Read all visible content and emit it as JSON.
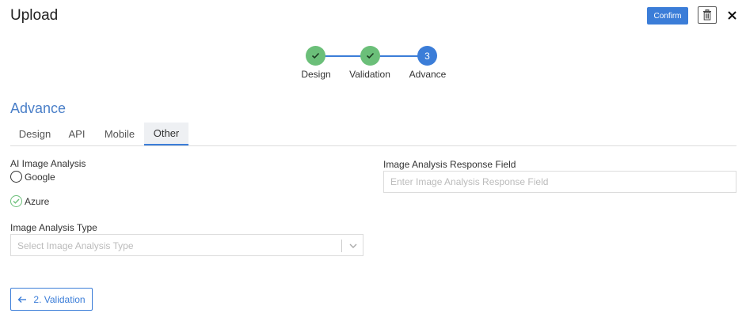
{
  "header": {
    "title": "Upload",
    "confirm_label": "Confirm"
  },
  "stepper": {
    "steps": [
      {
        "label": "Design",
        "status": "done"
      },
      {
        "label": "Validation",
        "status": "done"
      },
      {
        "label": "Advance",
        "status": "active",
        "number": "3"
      }
    ]
  },
  "section": {
    "title": "Advance",
    "tabs": [
      {
        "label": "Design",
        "active": false
      },
      {
        "label": "API",
        "active": false
      },
      {
        "label": "Mobile",
        "active": false
      },
      {
        "label": "Other",
        "active": true
      }
    ]
  },
  "form": {
    "ai_analysis": {
      "label": "AI Image Analysis",
      "options": [
        {
          "label": "Google",
          "selected": false
        },
        {
          "label": "Azure",
          "selected": true
        }
      ]
    },
    "analysis_type": {
      "label": "Image Analysis Type",
      "placeholder": "Select Image Analysis Type"
    },
    "response_field": {
      "label": "Image Analysis Response Field",
      "placeholder": "Enter Image Analysis Response Field",
      "value": ""
    }
  },
  "footer": {
    "back_label": "2. Validation"
  },
  "colors": {
    "accent": "#3b7dd8",
    "success": "#6bbf79",
    "section_title": "#4a7fc8"
  }
}
